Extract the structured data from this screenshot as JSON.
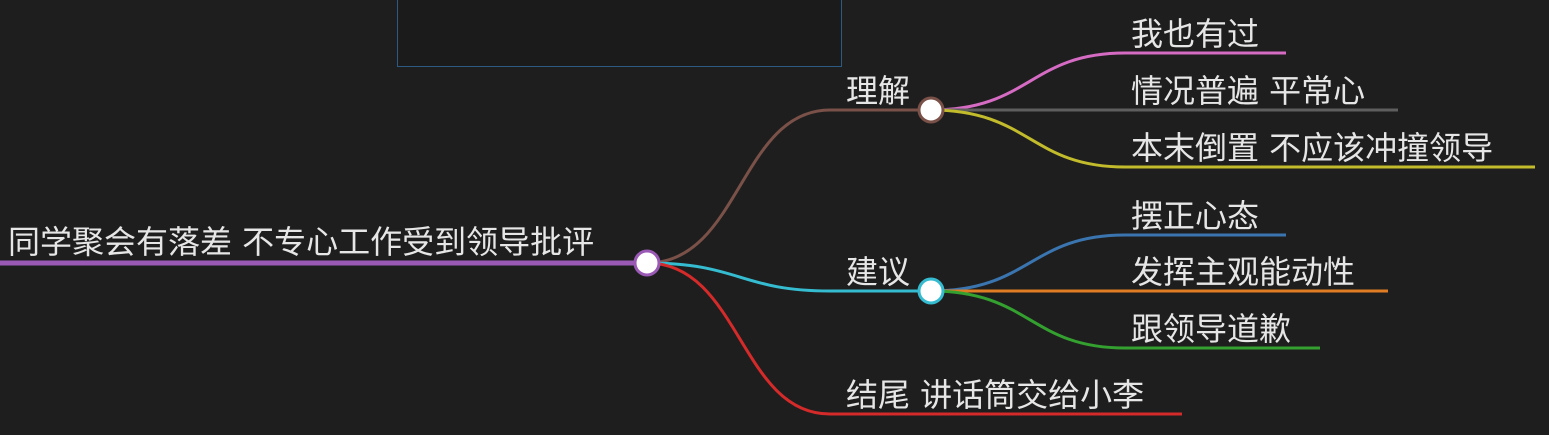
{
  "mindmap": {
    "root": {
      "label": "同学聚会有落差 不专心工作受到领导批评",
      "color": "#9a59b5"
    },
    "branches": [
      {
        "label": "理解",
        "color": "#7a5148",
        "children": [
          {
            "label": "我也有过",
            "color": "#d66bc4"
          },
          {
            "label": "情况普遍 平常心",
            "color": "#5e5e5e"
          },
          {
            "label": "本末倒置 不应该冲撞领导",
            "color": "#c2bb2c"
          }
        ]
      },
      {
        "label": "建议",
        "color": "#35bcd0",
        "children": [
          {
            "label": "摆正心态",
            "color": "#3a75b0"
          },
          {
            "label": "发挥主观能动性",
            "color": "#e07c23"
          },
          {
            "label": "跟领导道歉",
            "color": "#34a02f"
          }
        ]
      },
      {
        "label": "结尾 讲话筒交给小李",
        "color": "#d42a2a",
        "children": []
      }
    ]
  },
  "colors": {
    "background": "#1e1e1e",
    "text": "#e6e6e6",
    "node_fill": "#ffffff",
    "panel_border": "#2d5a85"
  }
}
